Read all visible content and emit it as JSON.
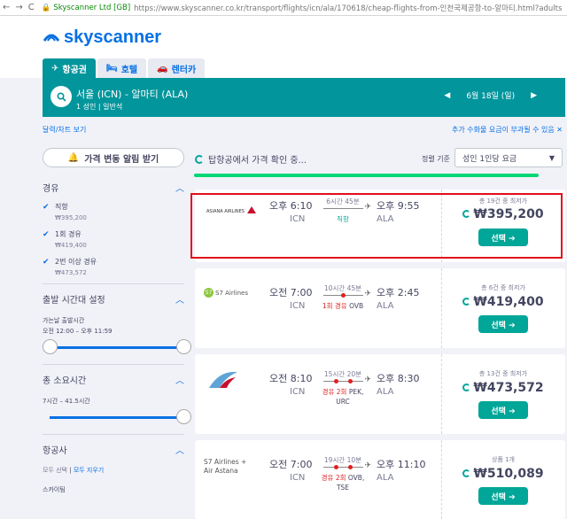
{
  "browser": {
    "nav_back": "←",
    "nav_forward": "→",
    "nav_reload": "C",
    "site_badge": "Skyscanner Ltd [GB]",
    "url": "https://www.skyscanner.co.kr/transport/flights/icn/ala/170618/cheap-flights-from-인천국제공항-to-알마티.html?adults"
  },
  "header": {
    "logo_text": "skyscanner",
    "tabs": [
      {
        "label": "항공권",
        "icon": "plane-icon"
      },
      {
        "label": "호텔",
        "icon": "bed-icon"
      },
      {
        "label": "렌터카",
        "icon": "car-icon"
      }
    ]
  },
  "search": {
    "route": "서울 (ICN) - 알마티 (ALA)",
    "passengers": "1 성인",
    "cabin": "일반석",
    "date": "6월 18일 (일)",
    "prev": "◀",
    "next": "▶"
  },
  "links": {
    "chart": "달력/차트 보기",
    "fees": "추가 수화물 요금이 부과될 수 있음 ✕"
  },
  "sidebar": {
    "alert_button": "가격 변동 알림 받기",
    "stops_title": "경유",
    "stops": [
      {
        "label": "직항",
        "price": "₩395,200"
      },
      {
        "label": "1회 경유",
        "price": "₩419,400"
      },
      {
        "label": "2번 이상 경유",
        "price": "₩473,572"
      }
    ],
    "departure_title": "출발 시간대 설정",
    "departure_label": "가는날 출발시간",
    "departure_range": "오전 12:00 – 오후 11:59",
    "duration_title": "총 소요시간",
    "duration_range": "7시간 – 41.5시간",
    "airlines_title": "항공사",
    "select_all": "모두 선택",
    "clear_all": "모두 지우기",
    "first_airline": "스카이팀"
  },
  "results": {
    "loading_text": "탑항공에서 가격 확인 중...",
    "sort_label": "정렬 기준",
    "sort_value": "성인 1인당 요금",
    "select_label": "선택 ➔",
    "cards": [
      {
        "airline": "ASIANA AIRLINES",
        "dep_time": "오후 6:10",
        "dep_code": "ICN",
        "duration": "6시간 45분",
        "stops": "직항",
        "stops_extra": "",
        "arr_time": "오후 9:55",
        "arr_code": "ALA",
        "deals": "총 19건 중 최저가",
        "price": "₩395,200"
      },
      {
        "airline": "S7 Airlines",
        "dep_time": "오전 7:00",
        "dep_code": "ICN",
        "duration": "10시간 45분",
        "stops": "1회 경유",
        "stops_extra": "OVB",
        "arr_time": "오후 2:45",
        "arr_code": "ALA",
        "deals": "총 6건 중 최저가",
        "price": "₩419,400"
      },
      {
        "airline": "China Southern",
        "dep_time": "오전 8:10",
        "dep_code": "ICN",
        "duration": "15시간 20분",
        "stops": "경유 2회",
        "stops_extra": "PEK, URC",
        "arr_time": "오후 8:30",
        "arr_code": "ALA",
        "deals": "총 13건 중 최저가",
        "price": "₩473,572"
      },
      {
        "airline": "S7 Airlines + Air Astana",
        "dep_time": "오전 7:00",
        "dep_code": "ICN",
        "duration": "19시간 10분",
        "stops": "경유 2회",
        "stops_extra": "OVB, TSE",
        "arr_time": "오후 11:10",
        "arr_code": "ALA",
        "deals": "상품 1개",
        "price": "₩510,089"
      }
    ]
  }
}
